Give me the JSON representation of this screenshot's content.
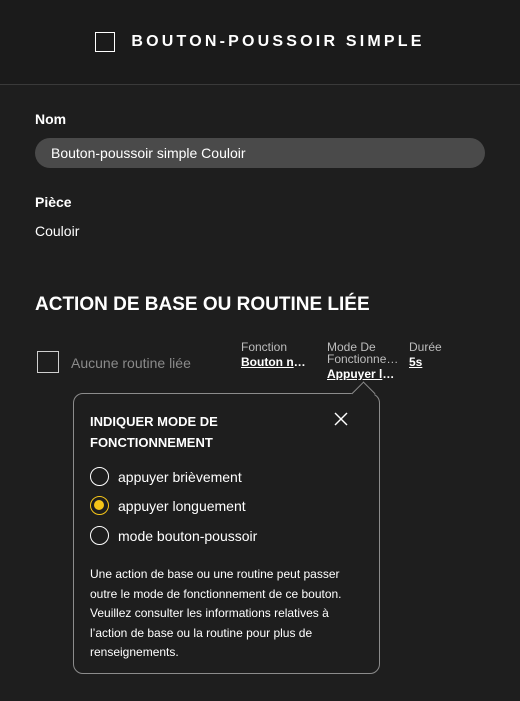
{
  "header": {
    "title": "BOUTON-POUSSOIR SIMPLE"
  },
  "form": {
    "name_label": "Nom",
    "name_value": "Bouton-poussoir simple Couloir",
    "room_label": "Pièce",
    "room_value": "Couloir"
  },
  "action": {
    "section_title": "ACTION DE BASE OU ROUTINE LIÉE",
    "routine_label": "Aucune routine liée",
    "columns": [
      {
        "header": "Fonction",
        "value": "Bouton nor…"
      },
      {
        "header": "Mode De Fonctionne…",
        "value": "Appuyer lo…"
      },
      {
        "header": "Durée",
        "value": "5s"
      }
    ]
  },
  "popup": {
    "title": "INDIQUER MODE DE FONCTIONNEMENT",
    "options": [
      {
        "label": "appuyer brièvement",
        "selected": false
      },
      {
        "label": "appuyer longuement",
        "selected": true
      },
      {
        "label": "mode bouton-poussoir",
        "selected": false
      }
    ],
    "note": "Une action de base ou une routine peut passer outre le mode de fonctionnement de ce bouton. Veuillez consulter les informations relatives à l’action de base ou la routine pour plus de renseignements.",
    "close_icon": "close-icon"
  },
  "colors": {
    "accent": "#f5c518",
    "background": "#1e1e1e",
    "input_bg": "#4a4a4a"
  }
}
